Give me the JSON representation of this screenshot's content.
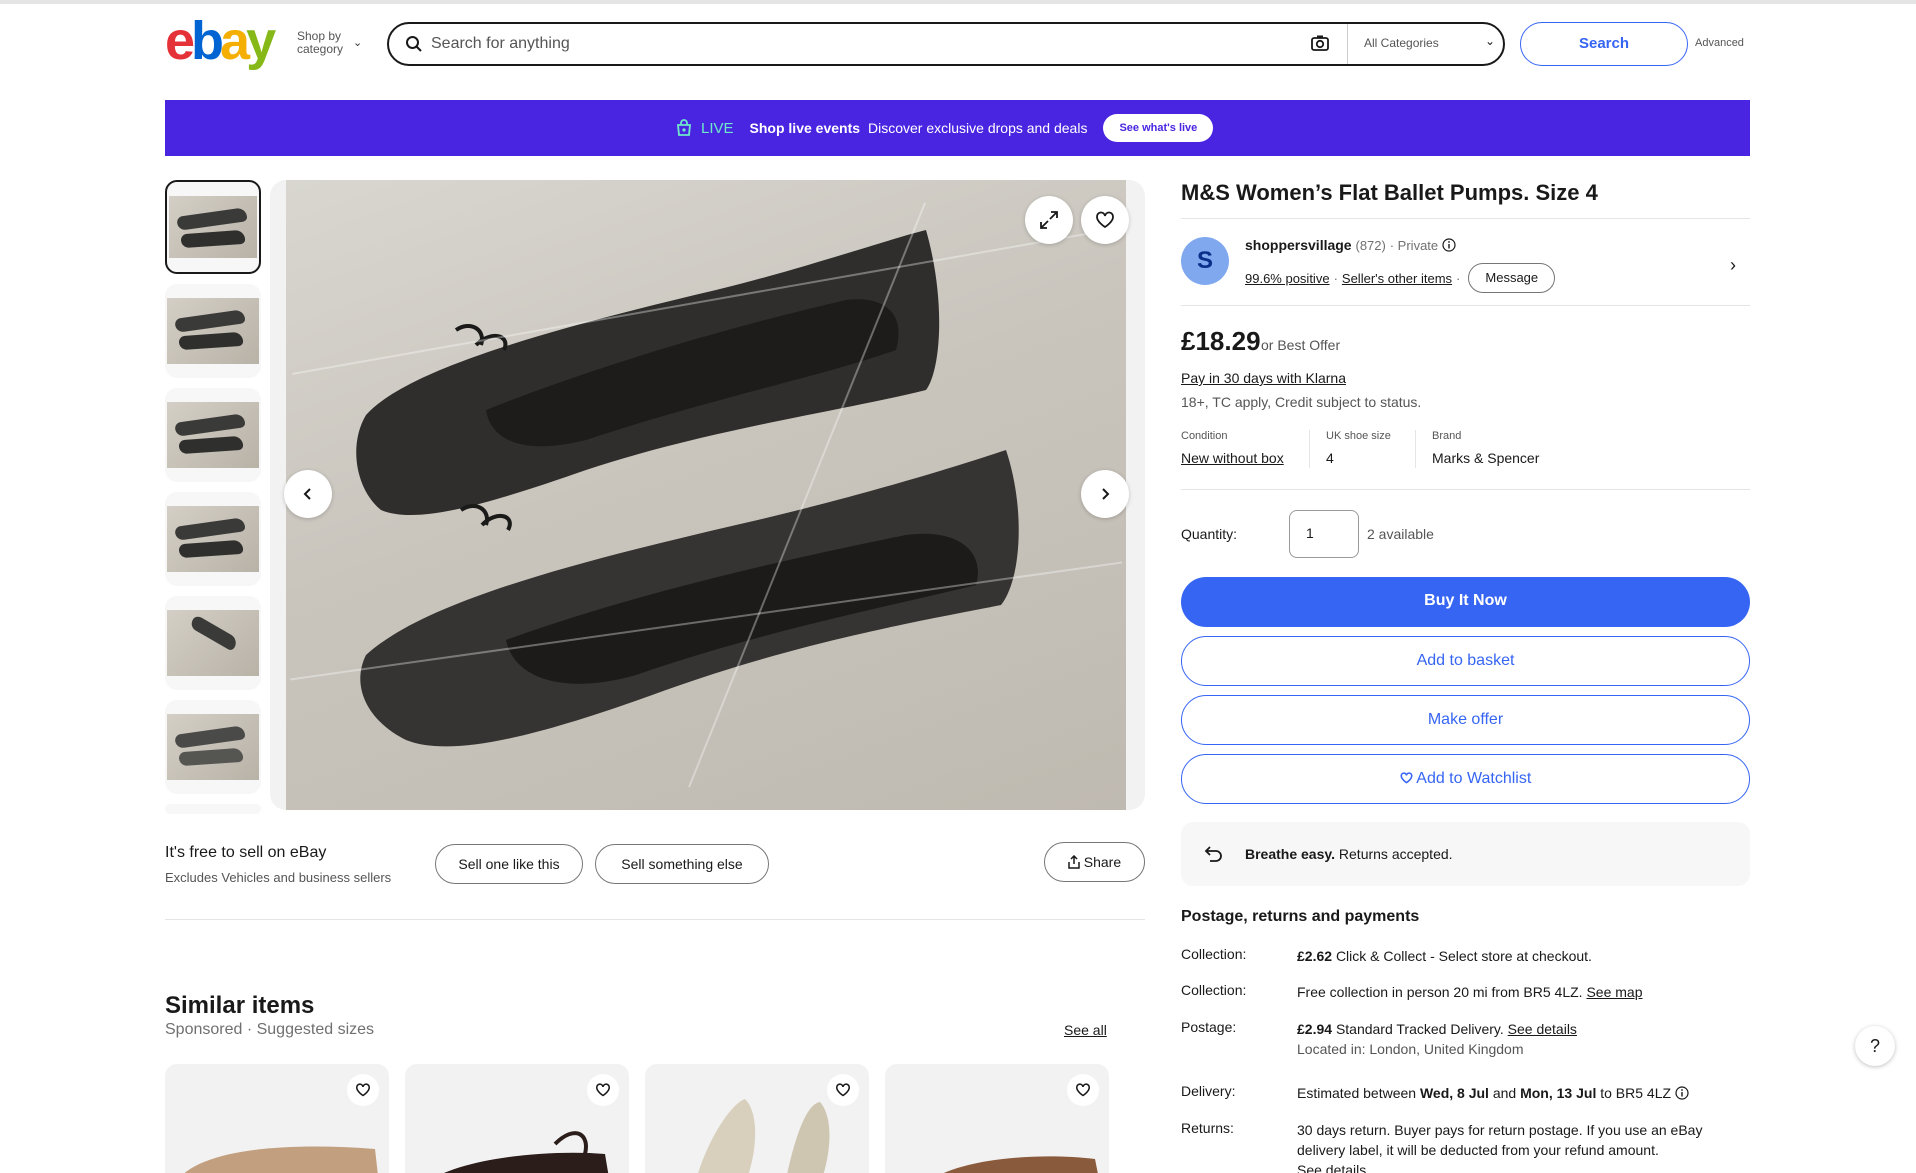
{
  "header": {
    "logo": {
      "e": "e",
      "b": "b",
      "a": "a",
      "y": "y"
    },
    "shop_by_line1": "Shop by",
    "shop_by_line2": "category",
    "search_placeholder": "Search for anything",
    "category": "All Categories",
    "search_button": "Search",
    "advanced": "Advanced"
  },
  "banner": {
    "live": "LIVE",
    "title": "Shop live events",
    "text": "Discover exclusive drops and deals",
    "button": "See what's live"
  },
  "sell": {
    "title": "It's free to sell on eBay",
    "subtitle": "Excludes Vehicles and business sellers",
    "sell_like": "Sell one like this",
    "sell_else": "Sell something else",
    "share": "Share"
  },
  "similar": {
    "title": "Similar items",
    "subtitle": "Sponsored · Suggested sizes",
    "see_all": "See all"
  },
  "item": {
    "title": "M&S Women’s Flat Ballet Pumps. Size 4",
    "seller": {
      "initial": "S",
      "name": "shoppersvillage",
      "feedback": "(872)",
      "type": "· Private",
      "positive": "99.6% positive",
      "other_items": "Seller's other items",
      "message": "Message"
    },
    "price": "£18.29",
    "best_offer": "or Best Offer",
    "klarna": "Pay in 30 days with Klarna",
    "tc": "18+, TC apply, Credit subject to status.",
    "specs": [
      {
        "label": "Condition",
        "value": "New without box"
      },
      {
        "label": "UK shoe size",
        "value": "4"
      },
      {
        "label": "Brand",
        "value": "Marks & Spencer"
      }
    ],
    "quantity_label": "Quantity:",
    "quantity": "1",
    "available": "2 available",
    "buy_now": "Buy It Now",
    "add_basket": "Add to basket",
    "make_offer": "Make offer",
    "watchlist": "Add to Watchlist",
    "returns_bold": "Breathe easy.",
    "returns_text": "Returns accepted."
  },
  "postage": {
    "title": "Postage, returns and payments",
    "rows": [
      {
        "label": "Collection:",
        "bold": "£2.62",
        "text": "Click & Collect - Select store at checkout."
      },
      {
        "label": "Collection:",
        "text": "Free collection in person 20 mi from BR5 4LZ.",
        "link": "See map"
      },
      {
        "label": "Postage:",
        "bold": "£2.94",
        "text": "Standard Tracked Delivery.",
        "link": "See details",
        "sub": "Located in: London, United Kingdom"
      },
      {
        "label": "Delivery:",
        "pre": "Estimated between",
        "d1": "Wed, 8 Jul",
        "mid": "and",
        "d2": "Mon, 13 Jul",
        "post": "to BR5 4LZ"
      },
      {
        "label": "Returns:",
        "text": "30 days return. Buyer pays for return postage. If you use an eBay delivery label, it will be deducted from your refund amount.",
        "link": "See details"
      }
    ]
  },
  "colors": {
    "primary": "#3665f3",
    "banner": "#4a25e1",
    "live": "#6fe9c9"
  }
}
